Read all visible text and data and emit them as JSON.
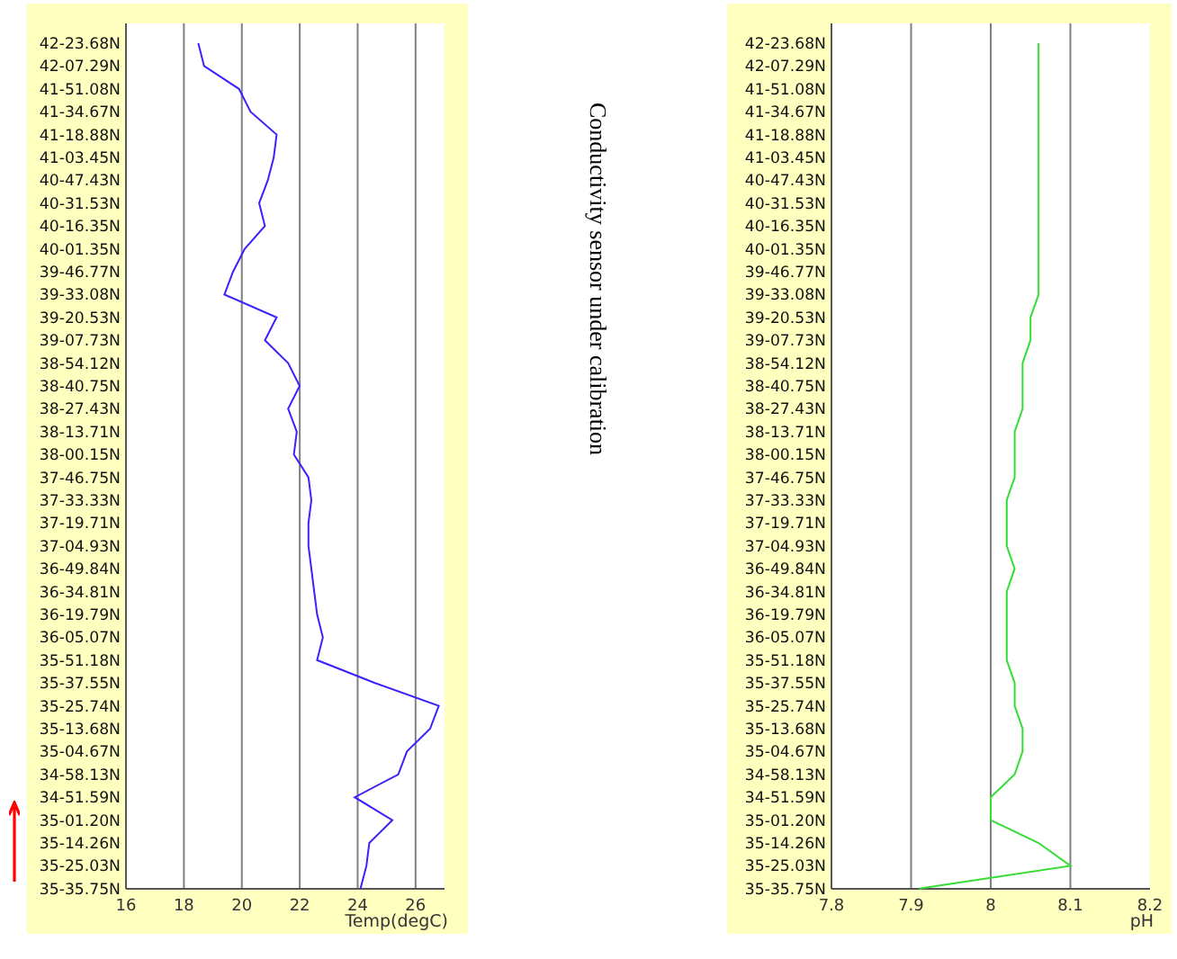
{
  "charts": [
    {
      "chart_data": {
        "type": "line",
        "orientation": "horizontal",
        "grid": true,
        "xlabel": "Temp(degC)",
        "xlim": [
          16,
          27
        ],
        "xticks": [
          16,
          18,
          20,
          22,
          24,
          26
        ],
        "categories": [
          "42-23.68N",
          "42-07.29N",
          "41-51.08N",
          "41-34.67N",
          "41-18.88N",
          "41-03.45N",
          "40-47.43N",
          "40-31.53N",
          "40-16.35N",
          "40-01.35N",
          "39-46.77N",
          "39-33.08N",
          "39-20.53N",
          "39-07.73N",
          "38-54.12N",
          "38-40.75N",
          "38-27.43N",
          "38-13.71N",
          "38-00.15N",
          "37-46.75N",
          "37-33.33N",
          "37-19.71N",
          "37-04.93N",
          "36-49.84N",
          "36-34.81N",
          "36-19.79N",
          "36-05.07N",
          "35-51.18N",
          "35-37.55N",
          "35-25.74N",
          "35-13.68N",
          "35-04.67N",
          "34-58.13N",
          "34-51.59N",
          "35-01.20N",
          "35-14.26N",
          "35-25.03N",
          "35-35.75N"
        ],
        "series": [
          {
            "color": "#3a22ff",
            "values": [
              18.5,
              18.7,
              19.9,
              20.3,
              21.2,
              21.1,
              20.9,
              20.6,
              20.8,
              20.1,
              19.7,
              19.4,
              21.2,
              20.8,
              21.6,
              22.0,
              21.6,
              21.9,
              21.8,
              22.3,
              22.4,
              22.3,
              22.3,
              22.4,
              22.5,
              22.6,
              22.8,
              22.6,
              24.6,
              26.8,
              26.5,
              25.7,
              25.4,
              23.9,
              25.2,
              24.4,
              24.3,
              24.1
            ]
          }
        ]
      }
    },
    {
      "chart_data": {
        "type": "line",
        "orientation": "horizontal",
        "grid": true,
        "xlabel": "pH",
        "xlim": [
          7.8,
          8.2
        ],
        "xticks": [
          7.8,
          7.9,
          8,
          8.1,
          8.2
        ],
        "categories": [
          "42-23.68N",
          "42-07.29N",
          "41-51.08N",
          "41-34.67N",
          "41-18.88N",
          "41-03.45N",
          "40-47.43N",
          "40-31.53N",
          "40-16.35N",
          "40-01.35N",
          "39-46.77N",
          "39-33.08N",
          "39-20.53N",
          "39-07.73N",
          "38-54.12N",
          "38-40.75N",
          "38-27.43N",
          "38-13.71N",
          "38-00.15N",
          "37-46.75N",
          "37-33.33N",
          "37-19.71N",
          "37-04.93N",
          "36-49.84N",
          "36-34.81N",
          "36-19.79N",
          "36-05.07N",
          "35-51.18N",
          "35-37.55N",
          "35-25.74N",
          "35-13.68N",
          "35-04.67N",
          "34-58.13N",
          "34-51.59N",
          "35-01.20N",
          "35-14.26N",
          "35-25.03N",
          "35-35.75N"
        ],
        "series": [
          {
            "color": "#33dd33",
            "values": [
              8.06,
              8.06,
              8.06,
              8.06,
              8.06,
              8.06,
              8.06,
              8.06,
              8.06,
              8.06,
              8.06,
              8.06,
              8.05,
              8.05,
              8.04,
              8.04,
              8.04,
              8.03,
              8.03,
              8.03,
              8.02,
              8.02,
              8.02,
              8.03,
              8.02,
              8.02,
              8.02,
              8.02,
              8.03,
              8.03,
              8.04,
              8.04,
              8.03,
              8.0,
              8.0,
              8.06,
              8.1,
              7.91
            ]
          }
        ]
      }
    }
  ],
  "note": "Conductivity sensor under calibration"
}
